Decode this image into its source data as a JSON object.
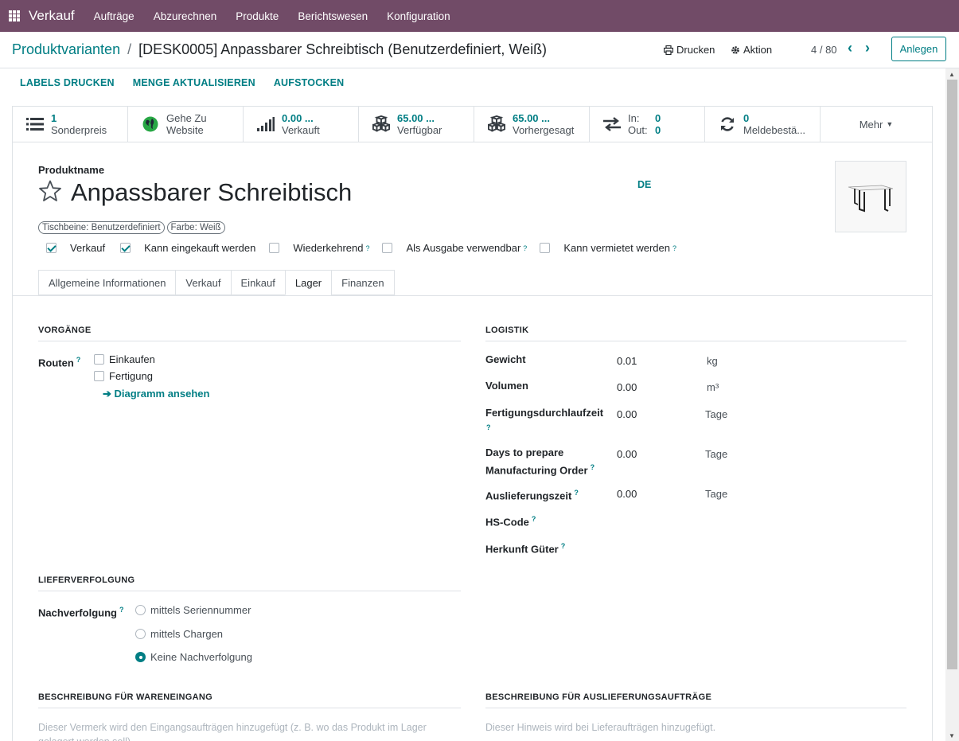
{
  "navbar": {
    "brand": "Verkauf",
    "menu": [
      "Aufträge",
      "Abzurechnen",
      "Produkte",
      "Berichtswesen",
      "Konfiguration"
    ]
  },
  "breadcrumb": {
    "parent": "Produktvarianten",
    "separator": "/",
    "current": "[DESK0005] Anpassbarer Schreibtisch (Benutzerdefiniert, Weiß)"
  },
  "control": {
    "print": "Drucken",
    "action": "Aktion",
    "pager": "4 / 80",
    "create": "Anlegen"
  },
  "actions": [
    "LABELS DRUCKEN",
    "MENGE AKTUALISIEREN",
    "AUFSTOCKEN"
  ],
  "smart_buttons": {
    "pricelist": {
      "value": "1",
      "label": "Sonderpreis",
      "icon": "list-icon"
    },
    "website": {
      "line1": "Gehe Zu",
      "line2": "Website",
      "icon": "globe-icon"
    },
    "sold": {
      "value": "0.00 ...",
      "label": "Verkauft",
      "icon": "signal-icon"
    },
    "available": {
      "value": "65.00 ...",
      "label": "Verfügbar",
      "icon": "cubes-icon"
    },
    "forecast": {
      "value": "65.00 ...",
      "label": "Vorhergesagt",
      "icon": "cubes-icon"
    },
    "inout": {
      "in_label": "In:",
      "in_value": "0",
      "out_label": "Out:",
      "out_value": "0",
      "icon": "exchange-icon"
    },
    "reorder": {
      "value": "0",
      "label": "Meldebestä...",
      "icon": "refresh-icon"
    },
    "more": "Mehr"
  },
  "product": {
    "name_label": "Produktname",
    "name": "Anpassbarer Schreibtisch",
    "lang": "DE",
    "tags": [
      "Tischbeine: Benutzerdefiniert",
      "Farbe: Weiß"
    ]
  },
  "flags": [
    {
      "label": "Verkauf",
      "checked": true,
      "help": false
    },
    {
      "label": "Kann eingekauft werden",
      "checked": true,
      "help": false
    },
    {
      "label": "Wiederkehrend",
      "checked": false,
      "help": true
    },
    {
      "label": "Als Ausgabe verwendbar",
      "checked": false,
      "help": true
    },
    {
      "label": "Kann vermietet werden",
      "checked": false,
      "help": true
    }
  ],
  "help_mark": "?",
  "tabs": [
    "Allgemeine Informationen",
    "Verkauf",
    "Einkauf",
    "Lager",
    "Finanzen"
  ],
  "active_tab": "Lager",
  "operations": {
    "title": "VORGÄNGE",
    "routes_label": "Routen",
    "routes": [
      {
        "label": "Einkaufen",
        "checked": false
      },
      {
        "label": "Fertigung",
        "checked": false
      }
    ],
    "diagram_link": "Diagramm ansehen"
  },
  "logistics": {
    "title": "LOGISTIK",
    "weight": {
      "label": "Gewicht",
      "value": "0.01",
      "unit": "kg"
    },
    "volume": {
      "label": "Volumen",
      "value": "0.00",
      "unit": "m³"
    },
    "mfg_lead": {
      "label": "Fertigungsdurchlaufzeit",
      "value": "0.00",
      "unit": "Tage"
    },
    "days_prepare": {
      "label_1": "Days to prepare",
      "label_2": "Manufacturing Order",
      "value": "0.00",
      "unit": "Tage"
    },
    "delivery": {
      "label": "Auslieferungszeit",
      "value": "0.00",
      "unit": "Tage"
    },
    "hs_code": {
      "label": "HS-Code"
    },
    "origin": {
      "label": "Herkunft Güter"
    }
  },
  "traceability": {
    "title": "LIEFERVERFOLGUNG",
    "label": "Nachverfolgung",
    "options": [
      {
        "label": "mittels Seriennummer",
        "selected": false
      },
      {
        "label": "mittels Chargen",
        "selected": false
      },
      {
        "label": "Keine Nachverfolgung",
        "selected": true
      }
    ]
  },
  "receipt_desc": {
    "title": "BESCHREIBUNG FÜR WARENEINGANG",
    "placeholder": "Dieser Vermerk wird den Eingangsaufträgen hinzugefügt (z. B. wo das Produkt im Lager gelagert werden soll)."
  },
  "delivery_desc": {
    "title": "BESCHREIBUNG FÜR AUSLIEFERUNGSAUFTRÄGE",
    "placeholder": "Dieser Hinweis wird bei Lieferaufträgen hinzugefügt."
  },
  "colors": {
    "primary": "#714b67",
    "accent": "#017e84"
  }
}
